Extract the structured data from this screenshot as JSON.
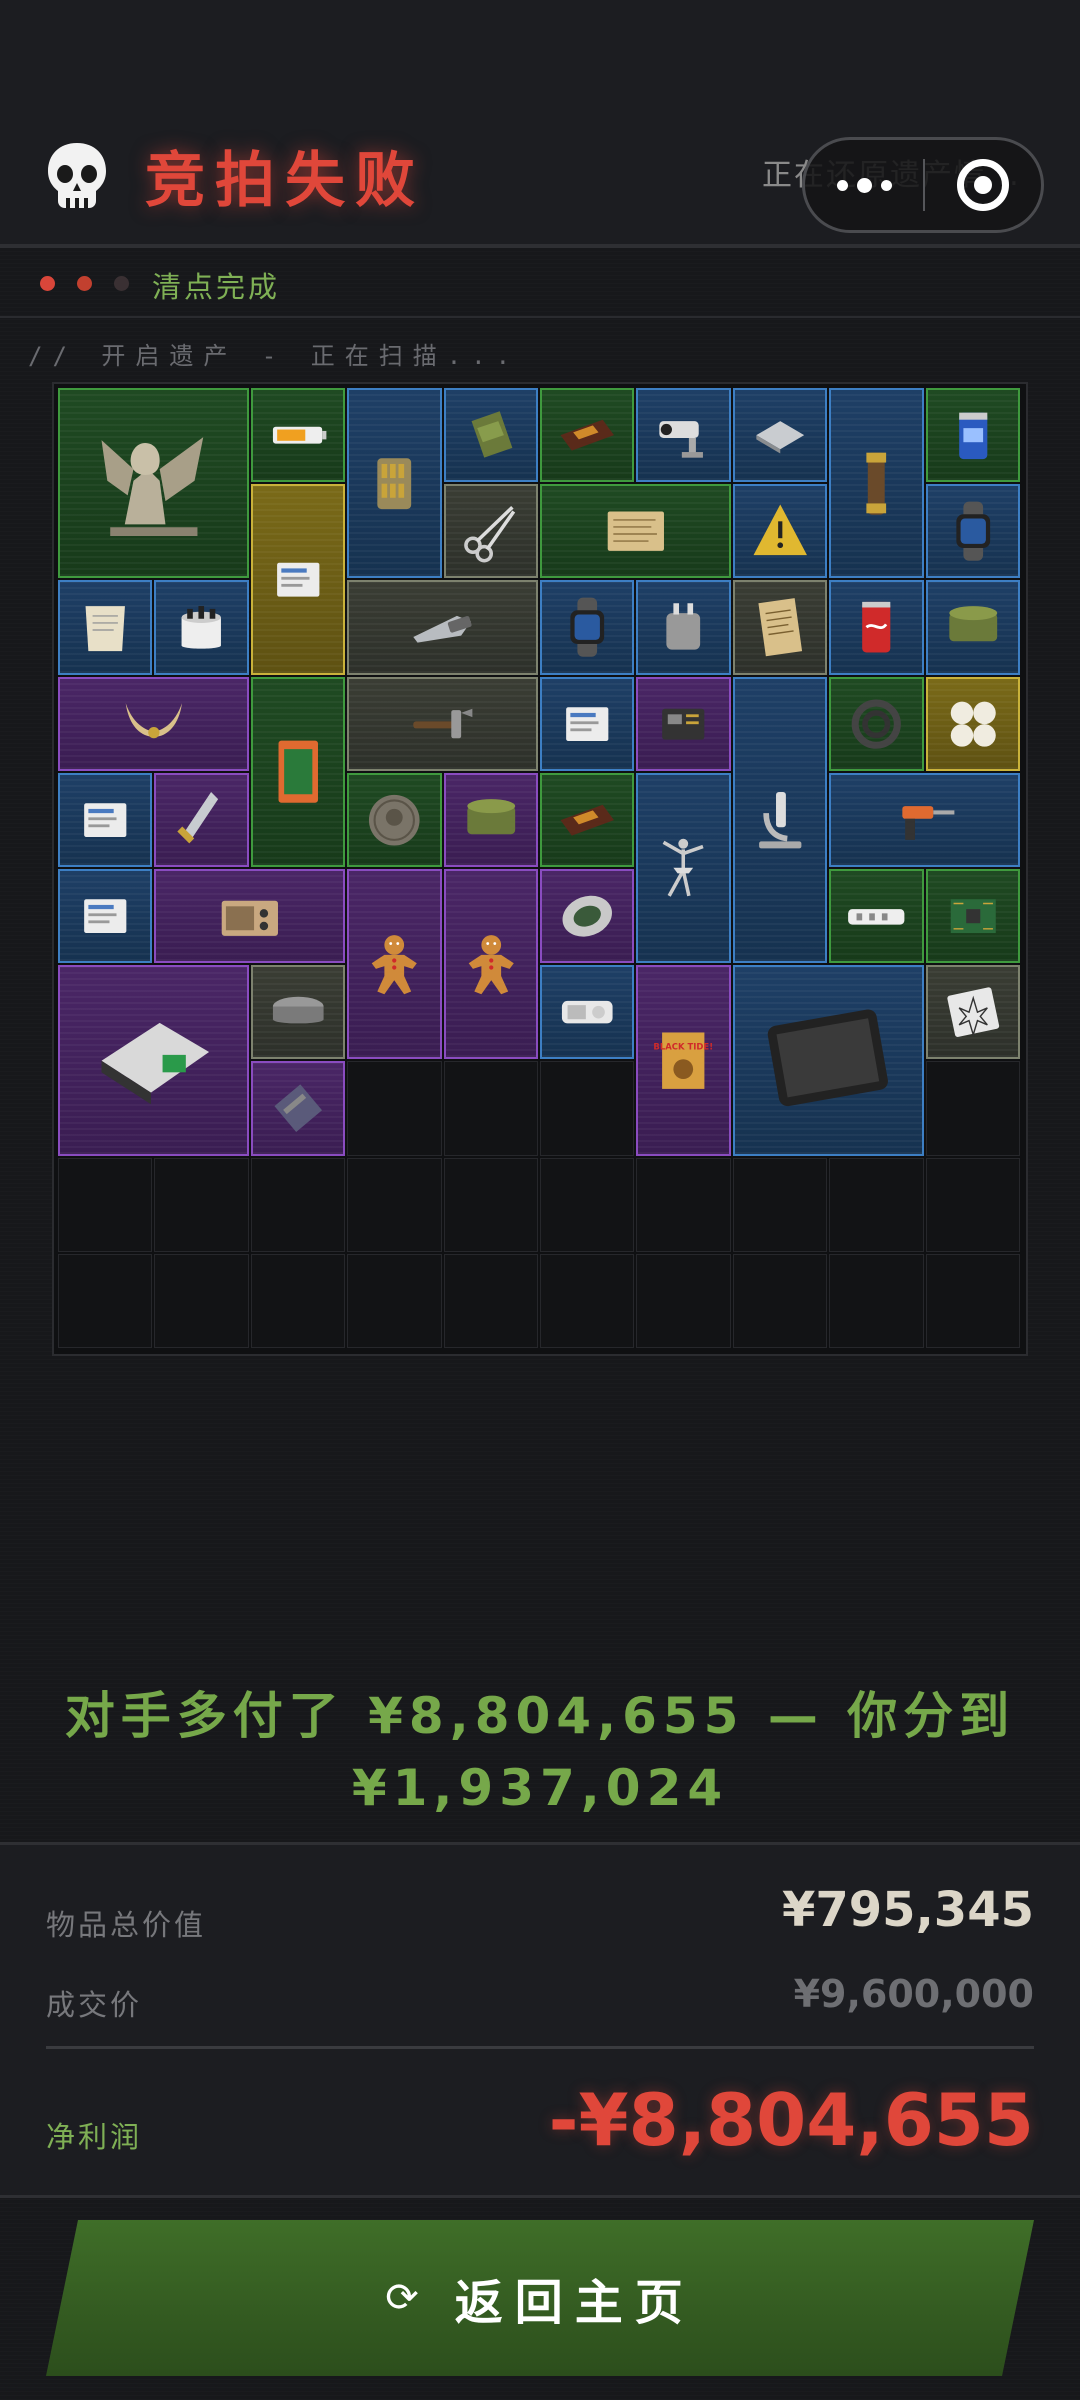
{
  "header": {
    "skull_icon": "skull-icon",
    "title": "竞拍失败",
    "status_right": "正在还原遗产情...",
    "menu_icon": "more-dots-icon",
    "close_icon": "target-circle-icon"
  },
  "progress": {
    "dots": [
      "#d9463a",
      "#c2402f",
      "#3a3033"
    ],
    "label": "清点完成"
  },
  "scan_text": "// 开启遗产 - 正在扫描...",
  "grid": {
    "columns": 10,
    "rows": 10,
    "items": [
      {
        "name": "winged-sphinx-statue",
        "rarity": "green",
        "icon": "sphinx-icon"
      },
      {
        "name": "battery-3000mah",
        "rarity": "green",
        "icon": "battery-icon"
      },
      {
        "name": "bullet-jar",
        "rarity": "blue",
        "icon": "bullet-jar-icon"
      },
      {
        "name": "ration-pack",
        "rarity": "blue",
        "icon": "pack-icon"
      },
      {
        "name": "chocolate-bar",
        "rarity": "green",
        "icon": "chocolate-icon"
      },
      {
        "name": "security-camera",
        "rarity": "blue",
        "icon": "camera-icon"
      },
      {
        "name": "metal-plate",
        "rarity": "blue",
        "icon": "plate-icon"
      },
      {
        "name": "telescope",
        "rarity": "blue",
        "icon": "telescope-icon"
      },
      {
        "name": "energy-can",
        "rarity": "green",
        "icon": "can-icon"
      },
      {
        "name": "document-card",
        "rarity": "gold",
        "icon": "card-icon"
      },
      {
        "name": "scissors",
        "rarity": "grey",
        "icon": "scissors-icon"
      },
      {
        "name": "old-map",
        "rarity": "green",
        "icon": "map-icon"
      },
      {
        "name": "warning-sign",
        "rarity": "blue",
        "icon": "triangle-icon"
      },
      {
        "name": "smart-watch",
        "rarity": "blue",
        "icon": "watch-icon"
      },
      {
        "name": "ration-pouch",
        "rarity": "blue",
        "icon": "pouch-icon"
      },
      {
        "name": "tub-container",
        "rarity": "blue",
        "icon": "tub-icon"
      },
      {
        "name": "utility-knife",
        "rarity": "grey",
        "icon": "knife-icon"
      },
      {
        "name": "smart-watch-2",
        "rarity": "blue",
        "icon": "watch-icon"
      },
      {
        "name": "power-adapter",
        "rarity": "blue",
        "icon": "adapter-icon"
      },
      {
        "name": "note-paper",
        "rarity": "grey",
        "icon": "note-icon"
      },
      {
        "name": "cola-can",
        "rarity": "blue",
        "icon": "cola-icon"
      },
      {
        "name": "tin-box",
        "rarity": "blue",
        "icon": "tin-icon"
      },
      {
        "name": "horned-mask",
        "rarity": "purple",
        "icon": "horns-icon"
      },
      {
        "name": "hazard-case",
        "rarity": "green",
        "icon": "case-icon"
      },
      {
        "name": "hammer",
        "rarity": "grey",
        "icon": "hammer-icon"
      },
      {
        "name": "data-card",
        "rarity": "blue",
        "icon": "card-icon"
      },
      {
        "name": "circuit-device",
        "rarity": "purple",
        "icon": "device-icon"
      },
      {
        "name": "microscope",
        "rarity": "blue",
        "icon": "microscope-icon"
      },
      {
        "name": "hose-coil",
        "rarity": "green",
        "icon": "coil-icon"
      },
      {
        "name": "pearls",
        "rarity": "gold",
        "icon": "pearl-icon"
      },
      {
        "name": "data-card-2",
        "rarity": "blue",
        "icon": "card-icon"
      },
      {
        "name": "dagger",
        "rarity": "purple",
        "icon": "dagger-icon"
      },
      {
        "name": "old-coin",
        "rarity": "green",
        "icon": "coin-icon"
      },
      {
        "name": "tobacco-tin",
        "rarity": "purple",
        "icon": "tin-icon"
      },
      {
        "name": "chocolate-bar-2",
        "rarity": "green",
        "icon": "chocolate-icon"
      },
      {
        "name": "ballerina-statue",
        "rarity": "blue",
        "icon": "ballerina-icon"
      },
      {
        "name": "power-drill",
        "rarity": "blue",
        "icon": "drill-icon"
      },
      {
        "name": "data-card-3",
        "rarity": "blue",
        "icon": "card-icon"
      },
      {
        "name": "radio",
        "rarity": "purple",
        "icon": "radio-icon"
      },
      {
        "name": "gingerbread-man",
        "rarity": "purple",
        "icon": "gingerbread-icon"
      },
      {
        "name": "gingerbread-man-2",
        "rarity": "purple",
        "icon": "gingerbread-icon"
      },
      {
        "name": "ornate-egg",
        "rarity": "purple",
        "icon": "egg-icon"
      },
      {
        "name": "power-strip",
        "rarity": "green",
        "icon": "strip-icon"
      },
      {
        "name": "circuit-board",
        "rarity": "green",
        "icon": "board-icon"
      },
      {
        "name": "ssd-drive",
        "rarity": "purple",
        "icon": "ssd-icon"
      },
      {
        "name": "tape-roll",
        "rarity": "grey",
        "icon": "tape-icon"
      },
      {
        "name": "mp3-player",
        "rarity": "blue",
        "icon": "player-icon"
      },
      {
        "name": "black-tide-book",
        "rarity": "purple",
        "icon": "book-icon"
      },
      {
        "name": "tablet",
        "rarity": "blue",
        "icon": "tablet-icon"
      },
      {
        "name": "emblem-card",
        "rarity": "grey",
        "icon": "emblem-icon"
      },
      {
        "name": "ram-stick",
        "rarity": "purple",
        "icon": "ram-icon"
      }
    ]
  },
  "summary": {
    "line1": "对手多付了 ¥8,804,655 — 你分到",
    "line2": "¥1,937,024"
  },
  "stats": {
    "total_label": "物品总价值",
    "total_value": "¥795,345",
    "deal_label": "成交价",
    "deal_value": "¥9,600,000",
    "net_label": "净利润",
    "net_value": "-¥8,804,655"
  },
  "home_button": {
    "icon": "refresh-icon",
    "label": "返回主页"
  },
  "colors": {
    "accent_red": "#e0473a",
    "accent_green": "#7fb055",
    "rarity_blue": "#3d7fc4",
    "rarity_green": "#3f9a3e",
    "rarity_purple": "#8a4cc0",
    "rarity_gold": "#c9b23a",
    "rarity_grey": "#7d826e"
  }
}
